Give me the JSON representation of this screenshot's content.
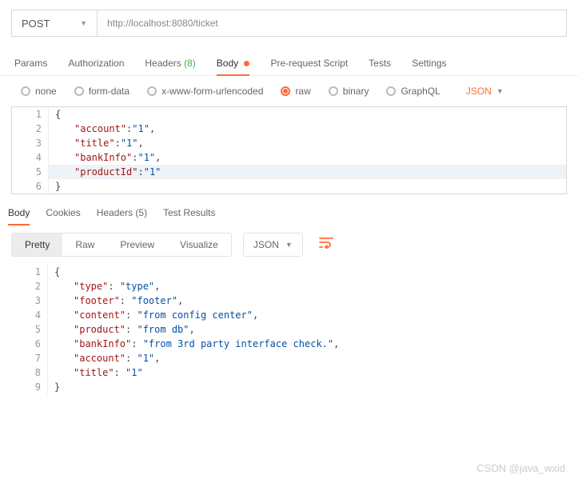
{
  "method": "POST",
  "url": "http://localhost:8080/ticket",
  "request_tabs": {
    "params": "Params",
    "authorization": "Authorization",
    "headers": "Headers",
    "headers_count": "(8)",
    "body": "Body",
    "pre_request": "Pre-request Script",
    "tests": "Tests",
    "settings": "Settings"
  },
  "body_type_options": {
    "none": "none",
    "form_data": "form-data",
    "urlencoded": "x-www-form-urlencoded",
    "raw": "raw",
    "binary": "binary",
    "graphql": "GraphQL"
  },
  "body_format": "JSON",
  "request_body_lines": {
    "l1": "{",
    "l2_key": "\"account\"",
    "l2_val": "\"1\"",
    "l3_key": "\"title\"",
    "l3_val": "\"1\"",
    "l4_key": "\"bankInfo\"",
    "l4_val": "\"1\"",
    "l5_key": "\"productId\"",
    "l5_val": "\"1\"",
    "l6": "}"
  },
  "response_tabs": {
    "body": "Body",
    "cookies": "Cookies",
    "headers": "Headers",
    "headers_count": "(5)",
    "test_results": "Test Results"
  },
  "response_view": {
    "pretty": "Pretty",
    "raw": "Raw",
    "preview": "Preview",
    "visualize": "Visualize",
    "format": "JSON"
  },
  "response_lines": {
    "l1": "{",
    "l2_key": "\"type\"",
    "l2_val": "\"type\"",
    "l3_key": "\"footer\"",
    "l3_val": "\"footer\"",
    "l4_key": "\"content\"",
    "l4_val": "\"from config center\"",
    "l5_key": "\"product\"",
    "l5_val": "\"from db\"",
    "l6_key": "\"bankInfo\"",
    "l6_val": "\"from 3rd party interface check.\"",
    "l7_key": "\"account\"",
    "l7_val": "\"1\"",
    "l8_key": "\"title\"",
    "l8_val": "\"1\"",
    "l9": "}"
  },
  "watermark": "CSDN @java_wxid"
}
